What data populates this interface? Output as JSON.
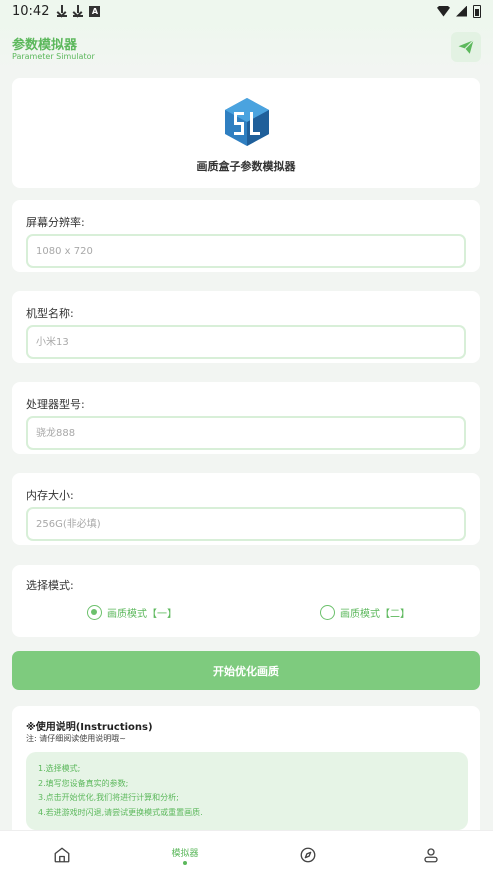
{
  "status_bar": {
    "time": "10:42"
  },
  "header": {
    "title": "参数模拟器",
    "subtitle": "Parameter Simulator"
  },
  "logo": {
    "caption": "画质盒子参数模拟器"
  },
  "fields": [
    {
      "label": "屏幕分辨率:",
      "placeholder": "1080 x 720"
    },
    {
      "label": "机型名称:",
      "placeholder": "小米13"
    },
    {
      "label": "处理器型号:",
      "placeholder": "骁龙888"
    },
    {
      "label": "内存大小:",
      "placeholder": "256G(非必填)"
    }
  ],
  "mode": {
    "label": "选择模式:",
    "options": [
      {
        "label": "画质模式【一】",
        "checked": true
      },
      {
        "label": "画质模式【二】",
        "checked": false
      }
    ]
  },
  "start_button": "开始优化画质",
  "instructions": {
    "title": "※使用说明(Instructions)",
    "note": "注: 请仔细阅读使用说明哦~",
    "steps": [
      "1.选择模式;",
      "2.填写您设备真实的参数;",
      "3.点击开始优化,我们将进行计算和分析;",
      "4.若进游戏时闪退,请尝试更换模式或重置画质."
    ]
  },
  "bottom_nav": {
    "active_label": "模拟器"
  },
  "colors": {
    "accent": "#5cb85c",
    "button": "#7ecb7e",
    "input_border": "#d8efd8"
  },
  "icons": [
    "download-icon",
    "app-a-icon",
    "wifi-icon",
    "signal-icon",
    "battery-icon",
    "send-icon",
    "home-icon",
    "compass-icon",
    "user-icon"
  ]
}
